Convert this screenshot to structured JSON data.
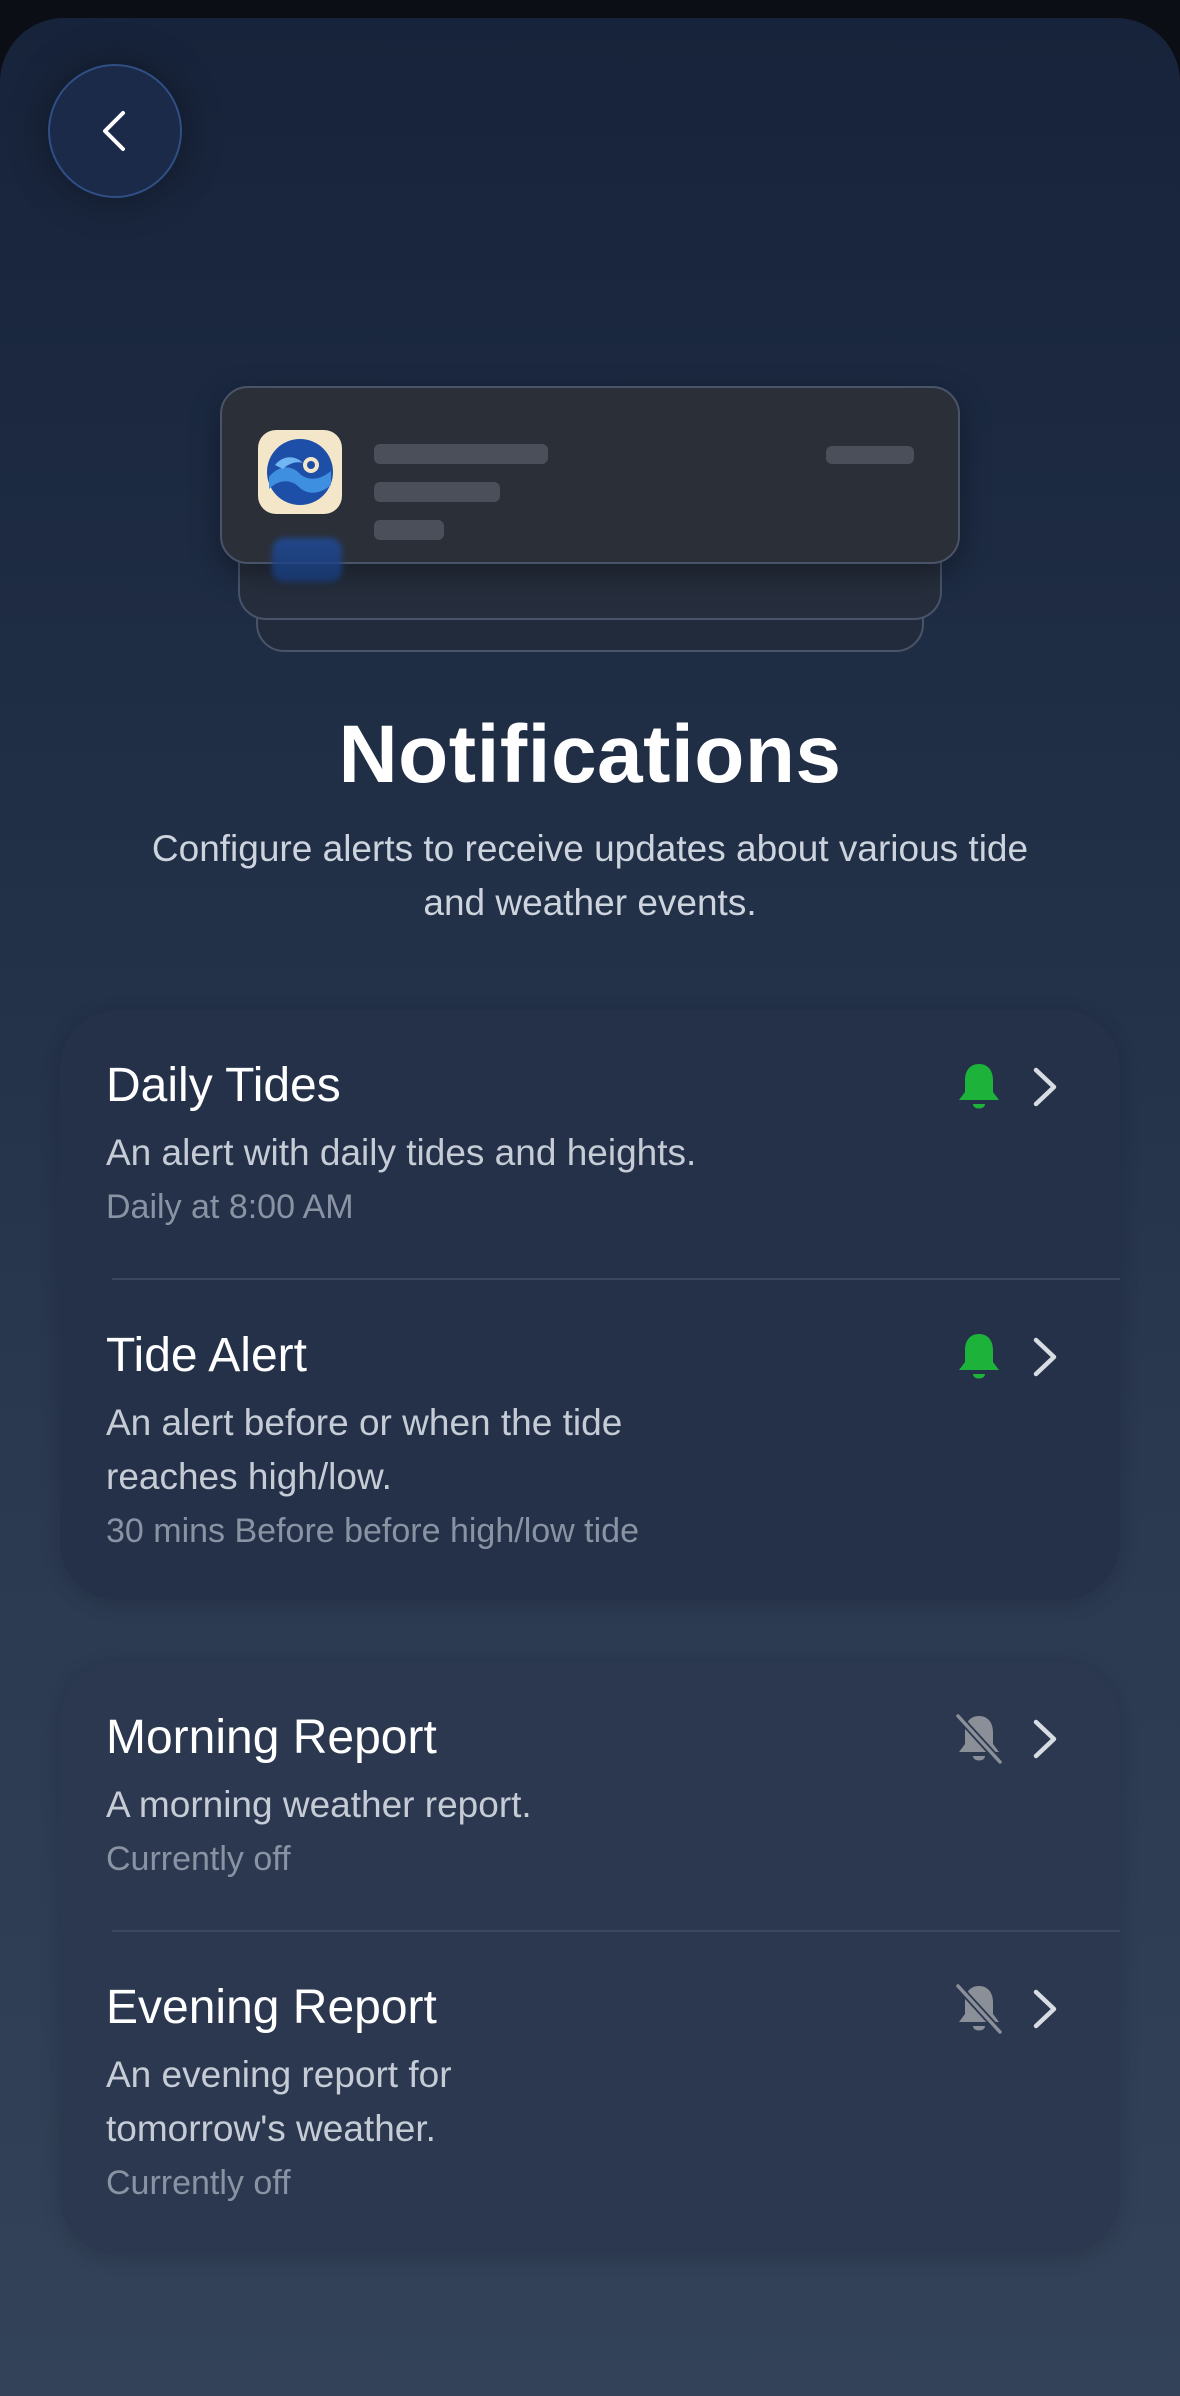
{
  "header": {
    "back_icon": "chevron-left-icon"
  },
  "illustration": {
    "app_icon": "tide-wave-icon"
  },
  "page": {
    "title": "Notifications",
    "subtitle": "Configure alerts to receive updates about various tide and weather events."
  },
  "groups": [
    {
      "items": [
        {
          "title": "Daily Tides",
          "description": "An alert with daily tides and heights.",
          "meta": "Daily at 8:00 AM",
          "enabled": true,
          "status_icon": "bell-icon"
        },
        {
          "title": "Tide Alert",
          "description": "An alert before or when the tide reaches high/low.",
          "meta": "30 mins Before before high/low tide",
          "enabled": true,
          "status_icon": "bell-icon"
        }
      ]
    },
    {
      "items": [
        {
          "title": "Morning Report",
          "description": "A morning weather report.",
          "meta": "Currently off",
          "enabled": false,
          "status_icon": "bell-off-icon"
        },
        {
          "title": "Evening Report",
          "description": "An evening report for tomorrow's weather.",
          "meta": "Currently off",
          "enabled": false,
          "status_icon": "bell-off-icon"
        }
      ]
    }
  ],
  "colors": {
    "enabled_bell": "#1db33a",
    "disabled_bell": "#8a8f98",
    "chevron": "#d8dce3"
  }
}
